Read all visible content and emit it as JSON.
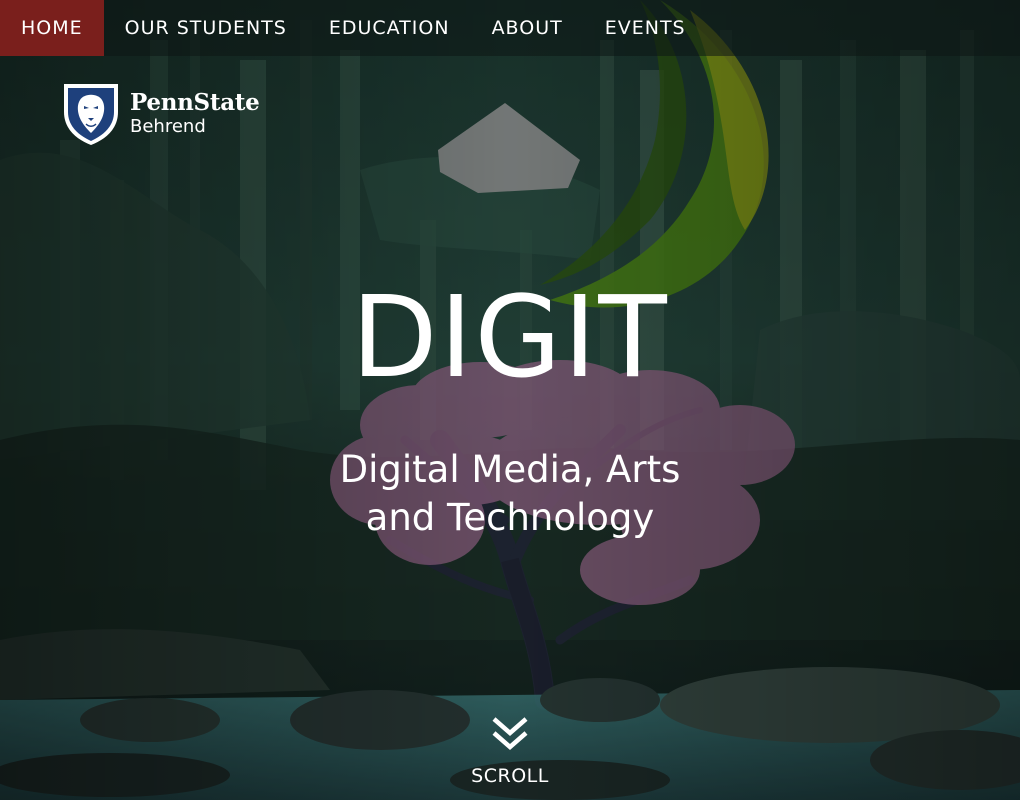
{
  "nav": {
    "items": [
      {
        "label": "HOME",
        "active": true
      },
      {
        "label": "OUR STUDENTS",
        "active": false
      },
      {
        "label": "EDUCATION",
        "active": false
      },
      {
        "label": "ABOUT",
        "active": false
      },
      {
        "label": "EVENTS",
        "active": false
      }
    ]
  },
  "logo": {
    "name": "PennState",
    "campus": "Behrend"
  },
  "hero": {
    "title": "DIGIT",
    "subtitle_line1": "Digital Media, Arts",
    "subtitle_line2": "and Technology"
  },
  "scroll": {
    "label": "SCROLL",
    "icon": "double-chevron-down-icon"
  },
  "colors": {
    "nav_active": "#7a1f1c",
    "text": "#ffffff",
    "shield_blue": "#1e407c"
  }
}
